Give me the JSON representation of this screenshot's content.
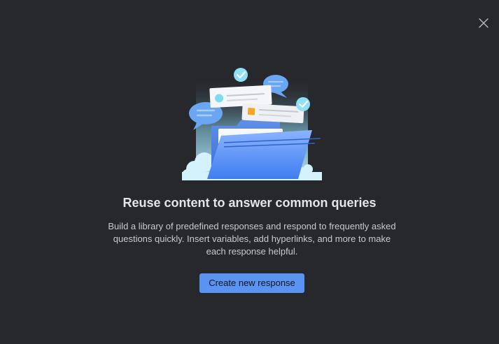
{
  "dialog": {
    "close_icon": "close-icon",
    "illustration": "folder-with-chat-bubbles-illustration",
    "title": "Reuse content to answer common queries",
    "description": "Build a library of predefined responses and respond to frequently asked questions quickly. Insert variables, add hyperlinks, and more to make each response helpful.",
    "primary_button_label": "Create new response"
  },
  "colors": {
    "background": "#27282c",
    "accent": "#5b93f2",
    "title_text": "#e4e5e8",
    "body_text": "#c9cace"
  }
}
